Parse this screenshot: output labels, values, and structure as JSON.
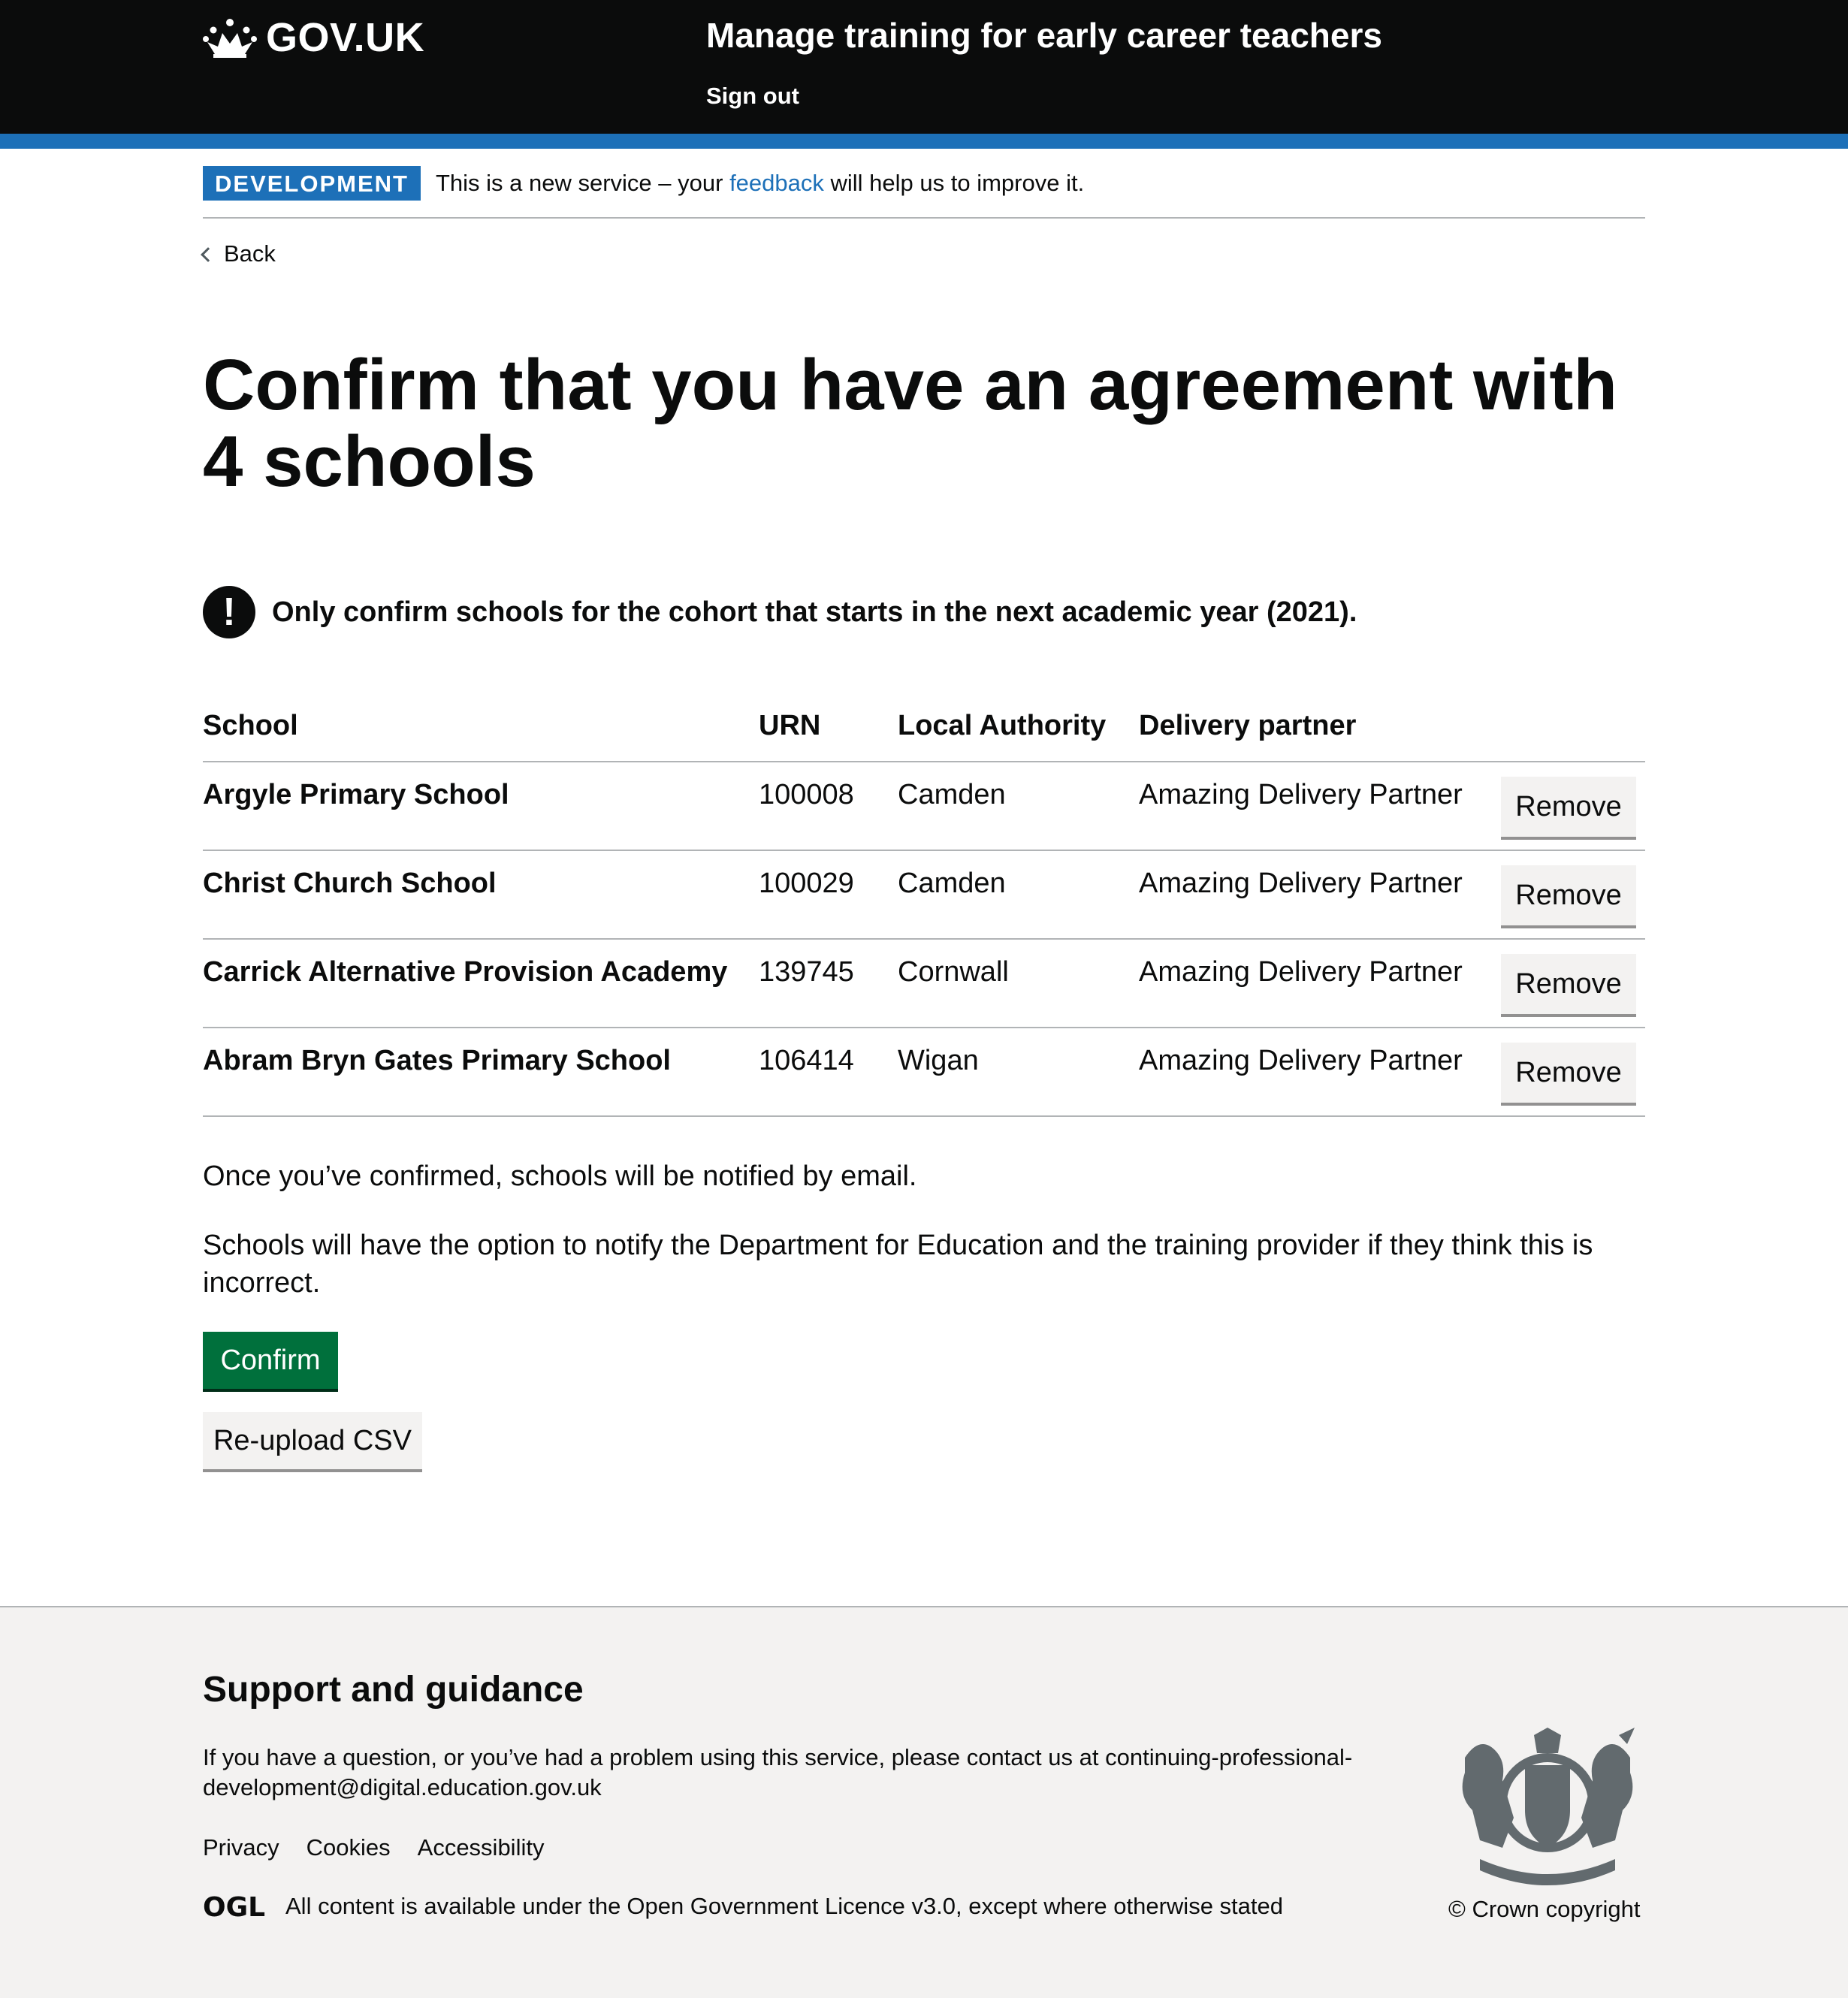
{
  "header": {
    "logo_text": "GOV.UK",
    "service_name": "Manage training for early career teachers",
    "sign_out": "Sign out"
  },
  "phase_banner": {
    "tag": "DEVELOPMENT",
    "text_before": "This is a new service – your ",
    "link": "feedback",
    "text_after": " will help us to improve it."
  },
  "back_link": "Back",
  "page_title": "Confirm that you have an agreement with 4 schools",
  "warning": {
    "icon": "!",
    "text": "Only confirm schools for the cohort that starts in the next academic year (2021)."
  },
  "table": {
    "headers": [
      "School",
      "URN",
      "Local Authority",
      "Delivery partner"
    ],
    "rows": [
      {
        "school": "Argyle Primary School",
        "urn": "100008",
        "la": "Camden",
        "dp": "Amazing Delivery Partner",
        "action": "Remove"
      },
      {
        "school": "Christ Church School",
        "urn": "100029",
        "la": "Camden",
        "dp": "Amazing Delivery Partner",
        "action": "Remove"
      },
      {
        "school": "Carrick Alternative Provision Academy",
        "urn": "139745",
        "la": "Cornwall",
        "dp": "Amazing Delivery Partner",
        "action": "Remove"
      },
      {
        "school": "Abram Bryn Gates Primary School",
        "urn": "106414",
        "la": "Wigan",
        "dp": "Amazing Delivery Partner",
        "action": "Remove"
      }
    ]
  },
  "body": {
    "p1": "Once you’ve confirmed, schools will be notified by email.",
    "p2": "Schools will have the option to notify the Department for Education and the training provider if they think this is incorrect."
  },
  "buttons": {
    "confirm": "Confirm",
    "reupload": "Re-upload CSV"
  },
  "footer": {
    "heading": "Support and guidance",
    "contact_text": "If you have a question, or you’ve had a problem using this service, please contact us at ",
    "contact_email": "continuing-professional-development@digital.education.gov.uk",
    "links": [
      "Privacy",
      "Cookies",
      "Accessibility"
    ],
    "ogl_logo": "OGL",
    "licence_before": "All content is available under the ",
    "licence_link": "Open Government Licence v3.0",
    "licence_after": ", except where otherwise stated",
    "crown_copyright": "© Crown copyright"
  },
  "colors": {
    "header_bg": "#0b0c0c",
    "brand_blue": "#1d70b8",
    "confirm_green": "#00703c",
    "footer_bg": "#f3f2f1"
  },
  "icons": [
    "crown-icon",
    "chevron-left-icon",
    "warning-icon",
    "ogl-logo",
    "royal-coat-of-arms-icon"
  ]
}
